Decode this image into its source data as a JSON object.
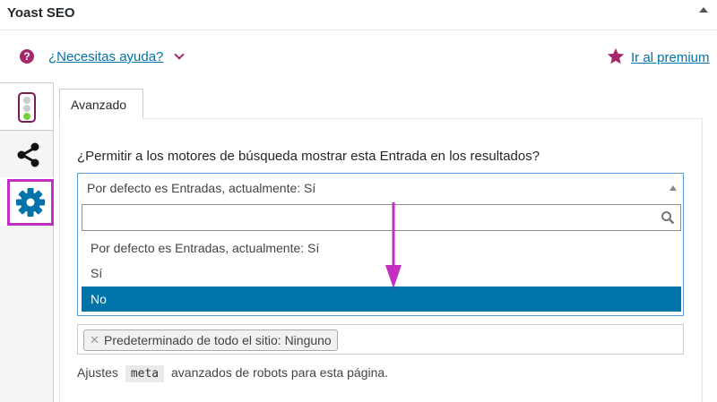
{
  "metabox": {
    "title": "Yoast SEO"
  },
  "helpbar": {
    "help_link": "¿Necesitas ayuda?",
    "premium_link": "Ir al premium"
  },
  "sidetabs": {
    "icons": [
      "traffic-light-icon",
      "share-icon",
      "gear-icon"
    ]
  },
  "panel": {
    "tab_label": "Avanzado",
    "question": "¿Permitir a los motores de búsqueda mostrar esta Entrada en los resultados?",
    "select": {
      "selected": "Por defecto es Entradas, actualmente: Sí",
      "search_value": "",
      "options": [
        "Por defecto es Entradas, actualmente: Sí",
        "Sí",
        "No"
      ],
      "highlighted": "No"
    },
    "robots_chip": "Predeterminado de todo el sitio: Ninguno",
    "help_text_before": "Ajustes",
    "help_text_code": "meta",
    "help_text_after": "avanzados de robots para esta página."
  },
  "colors": {
    "brand": "#a4286a",
    "link": "#0073aa",
    "highlight": "#0073aa",
    "annotation": "#c22fc2"
  }
}
